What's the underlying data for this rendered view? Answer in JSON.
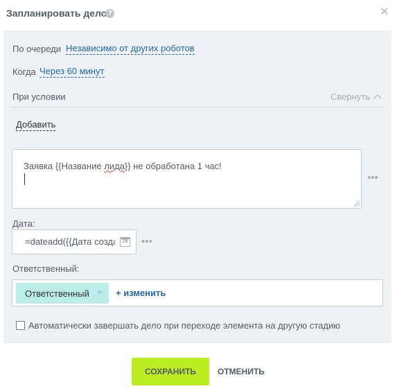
{
  "dialog": {
    "title": "Запланировать дело",
    "help_icon": "question-circle-icon",
    "close_icon": "close-icon"
  },
  "settings": {
    "queue_label": "По очереди",
    "queue_value": "Независимо от других роботов",
    "when_label": "Когда",
    "when_value": "Через 60 минут",
    "condition_label": "При условии",
    "collapse_label": "Свернуть",
    "add_label": "Добавить"
  },
  "message": {
    "text_before": "Заявка {{Название ",
    "text_misspelled": "лида",
    "text_after": "}} не обработана 1 час!"
  },
  "date": {
    "label": "Дата:",
    "value": "=dateadd({{Дата создания}}"
  },
  "responsible": {
    "label": "Ответственный:",
    "chip_label": "Ответственный",
    "chip_remove": "×",
    "change_label": "+ изменить"
  },
  "auto_complete": {
    "label": "Автоматически завершать дело при переходе элемента на другую стадию",
    "checked": false
  },
  "buttons": {
    "save": "СОХРАНИТЬ",
    "cancel": "ОТМЕНИТЬ"
  },
  "colors": {
    "accent_link": "#2067b0",
    "save_button": "#bbed21",
    "chip_bg": "#bbede9",
    "panel_bg": "#eef2f4"
  }
}
